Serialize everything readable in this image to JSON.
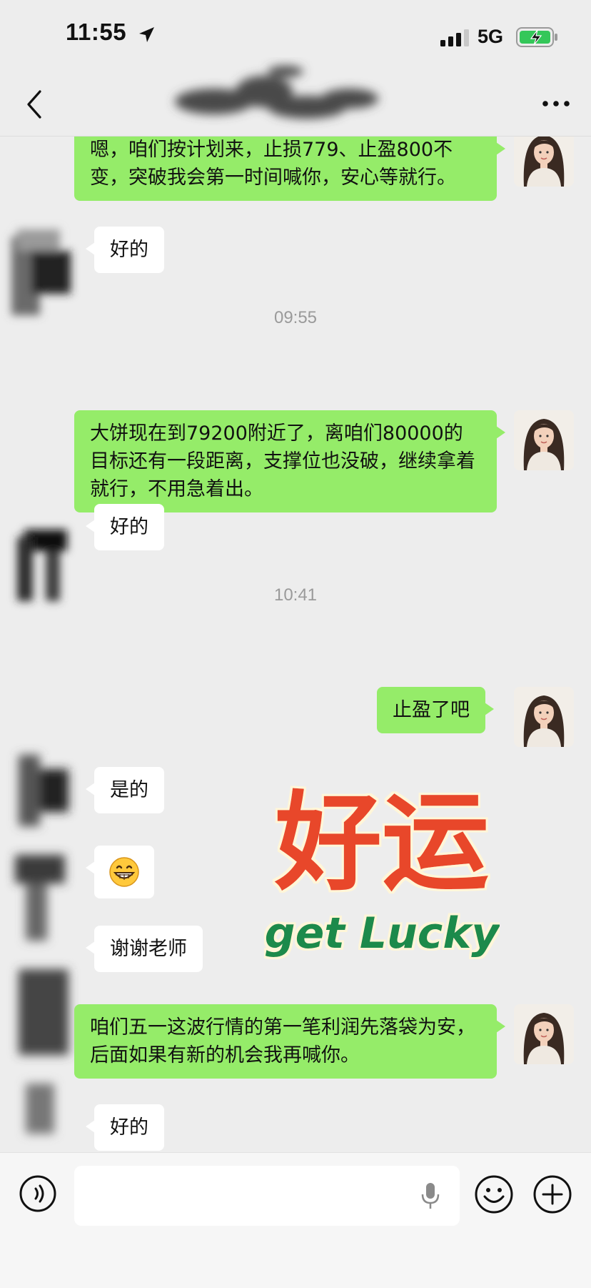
{
  "status_bar": {
    "time": "11:55",
    "network": "5G",
    "icons": [
      "location-arrow-icon",
      "signal-bars-icon",
      "battery-charging-icon"
    ]
  },
  "nav": {
    "icons": [
      "back-chevron-icon",
      "more-dots-icon"
    ]
  },
  "messages": [
    {
      "from": "me",
      "text": "嗯，咱们按计划来，止损779、止盈800不变，突破我会第一时间喊你，安心等就行。"
    },
    {
      "from": "other",
      "text": "好的"
    },
    {
      "type": "time",
      "text": "09:55"
    },
    {
      "from": "me",
      "text": "大饼现在到79200附近了，离咱们80000的目标还有一段距离，支撑位也没破，继续拿着就行，不用急着出。"
    },
    {
      "from": "other",
      "text": "好的"
    },
    {
      "type": "time",
      "text": "10:41"
    },
    {
      "from": "me",
      "text": "止盈了吧"
    },
    {
      "from": "other",
      "text": "是的"
    },
    {
      "from": "other",
      "emoji": "grinning-face-icon"
    },
    {
      "from": "other",
      "text": "谢谢老师"
    },
    {
      "from": "me",
      "text": "咱们五一这波行情的第一笔利润先落袋为安，后面如果有新的机会我再喊你。"
    },
    {
      "from": "other",
      "text": "好的"
    }
  ],
  "sticker": {
    "line1": "好运",
    "line2": "get Lucky",
    "colors": {
      "line1": "#e8472a",
      "line2": "#1f8a4c"
    }
  },
  "input_bar": {
    "placeholder": "",
    "icons": [
      "voice-icon",
      "microphone-icon",
      "emoji-icon",
      "plus-icon"
    ]
  },
  "colors": {
    "outgoing_bubble": "#95ec69",
    "incoming_bubble": "#ffffff",
    "background": "#ededed"
  }
}
